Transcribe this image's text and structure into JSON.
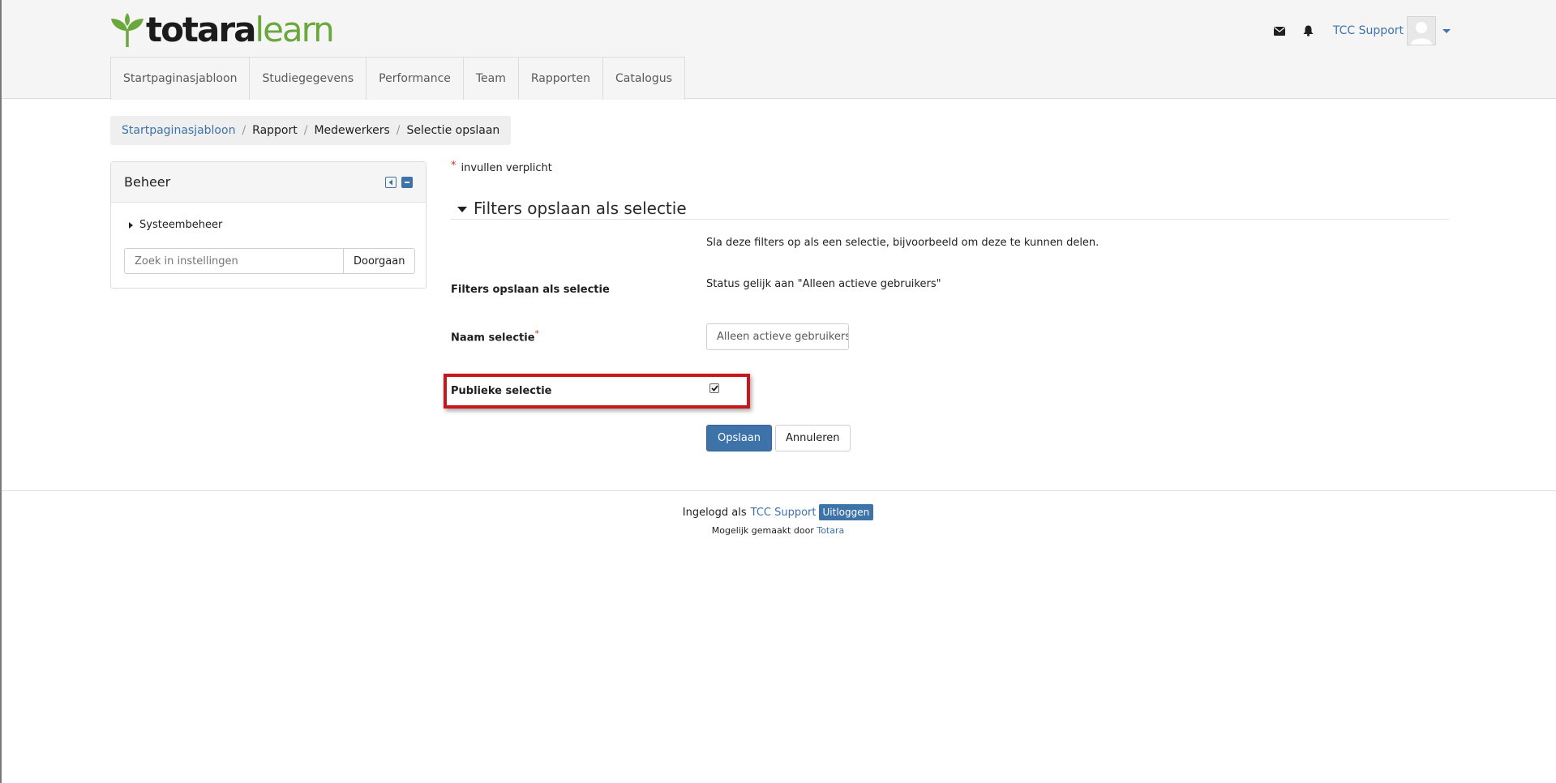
{
  "logo": {
    "part1": "totara",
    "part2": "learn",
    "brand_green": "#6aa83b"
  },
  "usernav": {
    "messages_icon": "envelope-icon",
    "notifications_icon": "bell-icon",
    "user_name": "TCC Support"
  },
  "mainnav": {
    "tabs": [
      "Startpaginasjabloon",
      "Studiegegevens",
      "Performance",
      "Team",
      "Rapporten",
      "Catalogus"
    ]
  },
  "breadcrumb": {
    "items": [
      "Startpaginasjabloon",
      "Rapport",
      "Medewerkers",
      "Selectie opslaan"
    ]
  },
  "block": {
    "title": "Beheer",
    "tree_item": "Systeembeheer",
    "search_placeholder": "Zoek in instellingen",
    "search_button": "Doorgaan"
  },
  "form": {
    "required_note": "invullen verplicht",
    "required_star": "*",
    "legend": "Filters opslaan als selectie",
    "description": "Sla deze filters op als een selectie, bijvoorbeeld om deze te kunnen delen.",
    "filters_label": "Filters opslaan als selectie",
    "filters_value": "Status gelijk aan \"Alleen actieve gebruikers\"",
    "name_label": "Naam selectie",
    "name_value": "Alleen actieve gebruikers",
    "public_label": "Publieke selectie",
    "public_checked": true,
    "save_button": "Opslaan",
    "cancel_button": "Annuleren"
  },
  "footer": {
    "logged_in_as": "Ingelogd als",
    "user_name": "TCC Support",
    "logout_button": "Uitloggen",
    "powered_by": "Mogelijk gemaakt door",
    "powered_link": "Totara"
  },
  "colors": {
    "link": "#3d73a8",
    "primary": "#3d73a8",
    "highlight": "#c8161d"
  }
}
